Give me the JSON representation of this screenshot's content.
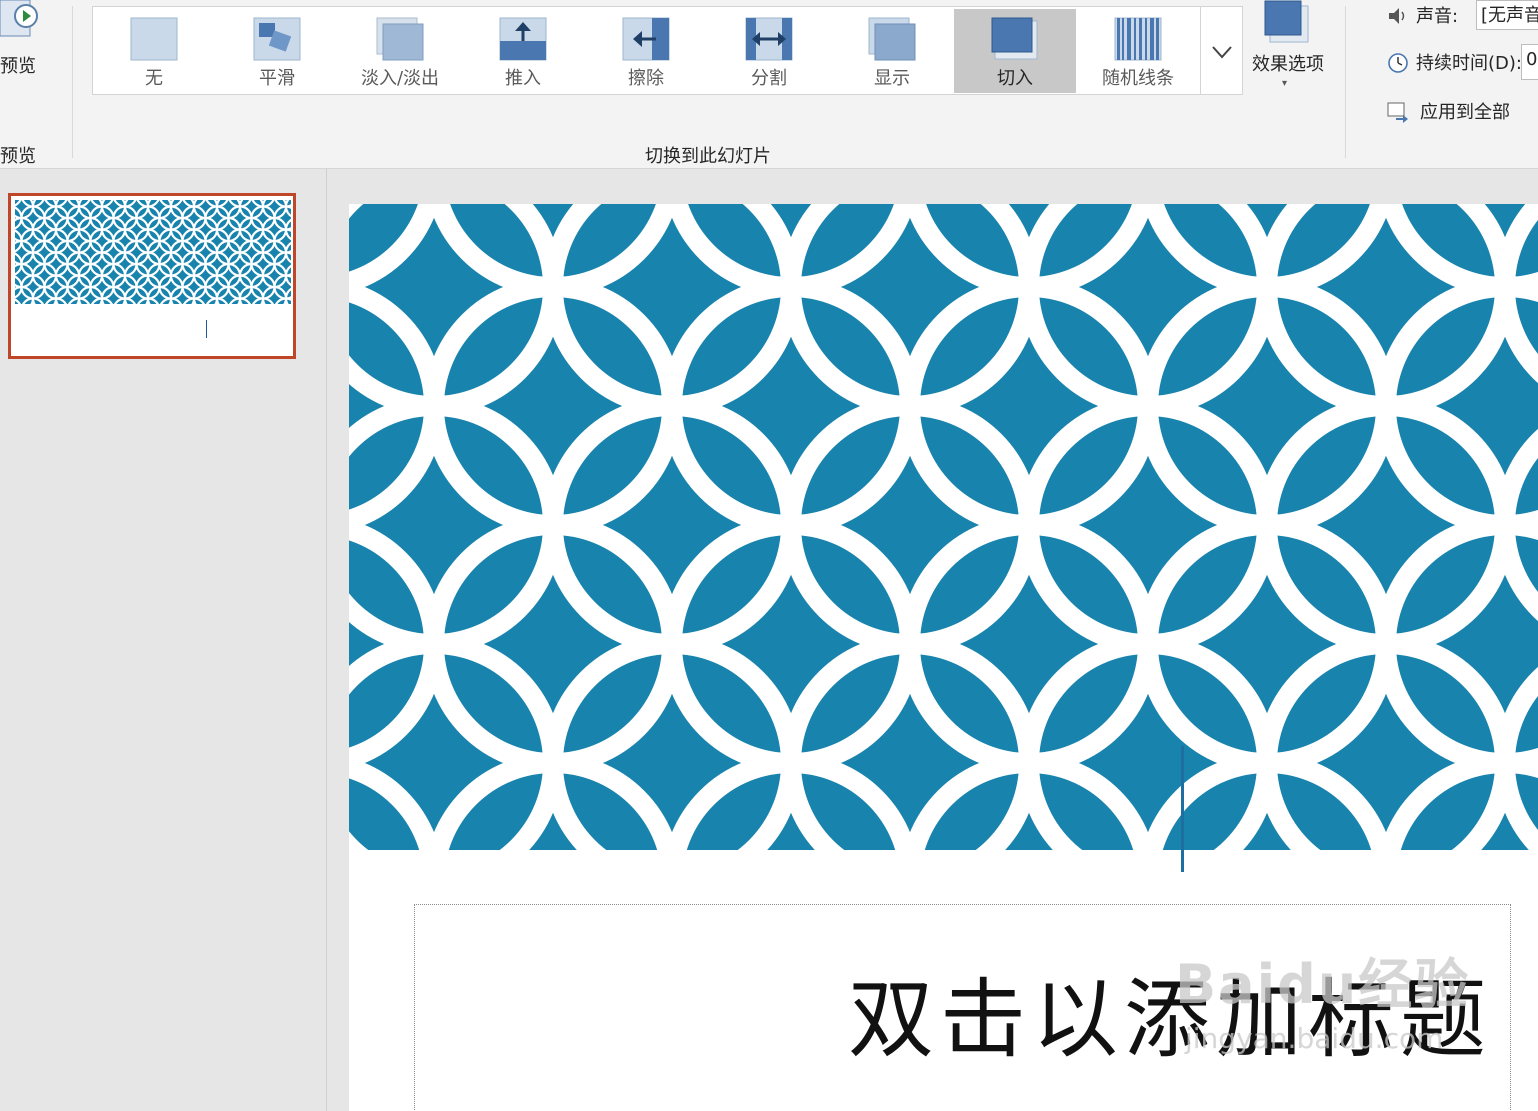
{
  "ribbon": {
    "preview": {
      "button_label": "预览",
      "group_label": "预览"
    },
    "transitions": {
      "group_label": "切换到此幻灯片",
      "items": [
        {
          "label": "无",
          "icon": "none-transition-icon"
        },
        {
          "label": "平滑",
          "icon": "morph-transition-icon"
        },
        {
          "label": "淡入/淡出",
          "icon": "fade-transition-icon"
        },
        {
          "label": "推入",
          "icon": "push-transition-icon"
        },
        {
          "label": "擦除",
          "icon": "wipe-transition-icon"
        },
        {
          "label": "分割",
          "icon": "split-transition-icon"
        },
        {
          "label": "显示",
          "icon": "reveal-transition-icon"
        },
        {
          "label": "切入",
          "icon": "cut-transition-icon",
          "selected": true
        },
        {
          "label": "随机线条",
          "icon": "random-bars-transition-icon"
        }
      ]
    },
    "effect_options": {
      "label": "效果选项"
    },
    "timing": {
      "sound_label": "声音:",
      "sound_value": "[无声音]",
      "duration_label": "持续时间(D):",
      "duration_value": "0",
      "apply_all_label": "应用到全部"
    }
  },
  "slide": {
    "title_placeholder": "双击以添加标题",
    "pattern_color": "#1883ad"
  },
  "watermark": {
    "logo": "Baidu经验",
    "url": "jingyan.baidu.com"
  },
  "colors": {
    "accent_selected_thumb": "#c0462a",
    "ribbon_bg": "#f3f3f3",
    "pane_bg": "#e6e6e6"
  }
}
